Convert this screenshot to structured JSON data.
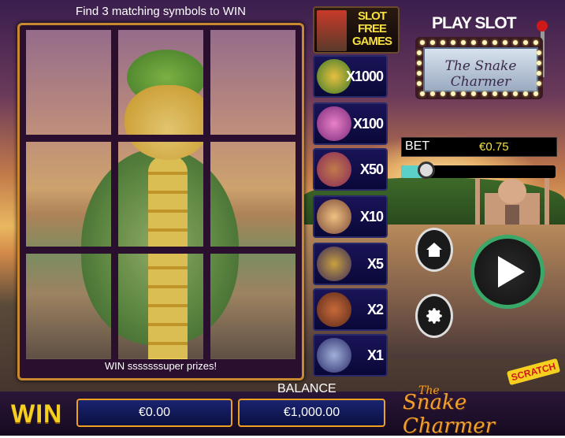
{
  "instructions": "Find 3 matching symbols to WIN",
  "card_footer": "WIN sssssssuper prizes!",
  "prizes": [
    {
      "multiplier": "SLOT FREE GAMES",
      "icon": "genie-charmer-icon"
    },
    {
      "multiplier": "X1000",
      "icon": "cobra-icon"
    },
    {
      "multiplier": "X100",
      "icon": "dancer-icon"
    },
    {
      "multiplier": "X50",
      "icon": "monkey-icon"
    },
    {
      "multiplier": "X10",
      "icon": "taj-mahal-icon"
    },
    {
      "multiplier": "X5",
      "icon": "flute-icon"
    },
    {
      "multiplier": "X2",
      "icon": "basket-icon"
    },
    {
      "multiplier": "X1",
      "icon": "pipe-icon"
    }
  ],
  "play_slot": {
    "label": "PLAY SLOT",
    "sign_text": "The Snake Charmer"
  },
  "bet": {
    "label": "BET",
    "value": "€0.75",
    "level_fraction": 0.12
  },
  "buttons": {
    "home": "home-icon",
    "settings": "gear-icon",
    "play": "play-icon"
  },
  "win": {
    "label": "WIN",
    "value": "€0.00"
  },
  "balance": {
    "label": "BALANCE",
    "value": "€1,000.00"
  },
  "brand": {
    "small": "The",
    "name": "Snake Charmer",
    "badge": "SCRATCH"
  }
}
